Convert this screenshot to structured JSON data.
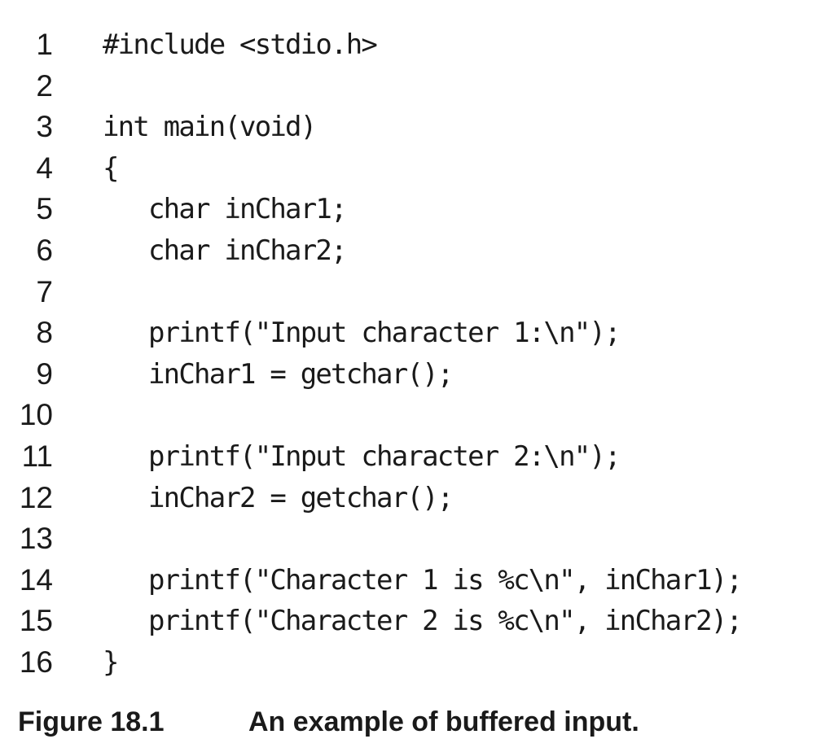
{
  "code_listing": {
    "lines": [
      {
        "number": "1",
        "code": "#include <stdio.h>"
      },
      {
        "number": "2",
        "code": ""
      },
      {
        "number": "3",
        "code": "int main(void)"
      },
      {
        "number": "4",
        "code": "{"
      },
      {
        "number": "5",
        "code": "   char inChar1;"
      },
      {
        "number": "6",
        "code": "   char inChar2;"
      },
      {
        "number": "7",
        "code": ""
      },
      {
        "number": "8",
        "code": "   printf(\"Input character 1:\\n\");"
      },
      {
        "number": "9",
        "code": "   inChar1 = getchar();"
      },
      {
        "number": "10",
        "code": ""
      },
      {
        "number": "11",
        "code": "   printf(\"Input character 2:\\n\");"
      },
      {
        "number": "12",
        "code": "   inChar2 = getchar();"
      },
      {
        "number": "13",
        "code": ""
      },
      {
        "number": "14",
        "code": "   printf(\"Character 1 is %c\\n\", inChar1);"
      },
      {
        "number": "15",
        "code": "   printf(\"Character 2 is %c\\n\", inChar2);"
      },
      {
        "number": "16",
        "code": "}"
      }
    ]
  },
  "caption": {
    "label": "Figure 18.1",
    "text": "An example of buffered input."
  }
}
